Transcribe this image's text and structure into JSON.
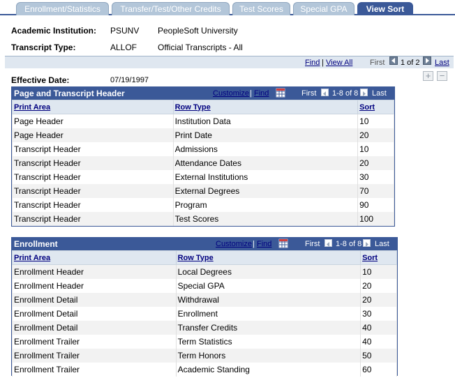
{
  "tabs": [
    {
      "label": "Enrollment/Statistics",
      "active": false
    },
    {
      "label": "Transfer/Test/Other Credits",
      "active": false
    },
    {
      "label": "Test Scores",
      "active": false
    },
    {
      "label": "Special GPA",
      "active": false
    },
    {
      "label": "View Sort",
      "active": true
    }
  ],
  "header": {
    "institution_label": "Academic Institution:",
    "institution_code": "PSUNV",
    "institution_name": "PeopleSoft University",
    "transcript_label": "Transcript Type:",
    "transcript_code": "ALLOF",
    "transcript_name": "Official Transcripts - All"
  },
  "top_nav": {
    "find": "Find",
    "sep": "|",
    "view_all": "View All",
    "first": "First",
    "count": "1 of 2",
    "last": "Last"
  },
  "effective": {
    "label": "Effective Date:",
    "value": "07/19/1997"
  },
  "grid_nav": {
    "customize": "Customize",
    "sep": "|",
    "find": "Find",
    "first": "First",
    "count": "1-8 of 8",
    "last": "Last"
  },
  "grid1": {
    "title": "Page and Transcript Header",
    "columns": [
      "Print Area",
      "Row Type",
      "Sort"
    ],
    "rows": [
      [
        "Page Header",
        "Institution Data",
        "10"
      ],
      [
        "Page Header",
        "Print Date",
        "20"
      ],
      [
        "Transcript Header",
        "Admissions",
        "10"
      ],
      [
        "Transcript Header",
        "Attendance Dates",
        "20"
      ],
      [
        "Transcript Header",
        "External Institutions",
        "30"
      ],
      [
        "Transcript Header",
        "External Degrees",
        "70"
      ],
      [
        "Transcript Header",
        "Program",
        "90"
      ],
      [
        "Transcript Header",
        "Test Scores",
        "100"
      ]
    ]
  },
  "grid2": {
    "title": "Enrollment",
    "columns": [
      "Print Area",
      "Row Type",
      "Sort"
    ],
    "rows": [
      [
        "Enrollment Header",
        "Local Degrees",
        "10"
      ],
      [
        "Enrollment Header",
        "Special GPA",
        "20"
      ],
      [
        "Enrollment Detail",
        "Withdrawal",
        "20"
      ],
      [
        "Enrollment Detail",
        "Enrollment",
        "30"
      ],
      [
        "Enrollment Detail",
        "Transfer Credits",
        "40"
      ],
      [
        "Enrollment Trailer",
        "Term Statistics",
        "40"
      ],
      [
        "Enrollment Trailer",
        "Term Honors",
        "50"
      ],
      [
        "Enrollment Trailer",
        "Academic Standing",
        "60"
      ]
    ]
  },
  "colors": {
    "tab_inactive": "#b3c6d9",
    "tab_active": "#3b5998",
    "grid_header": "#3b5998",
    "link": "#00007f"
  }
}
